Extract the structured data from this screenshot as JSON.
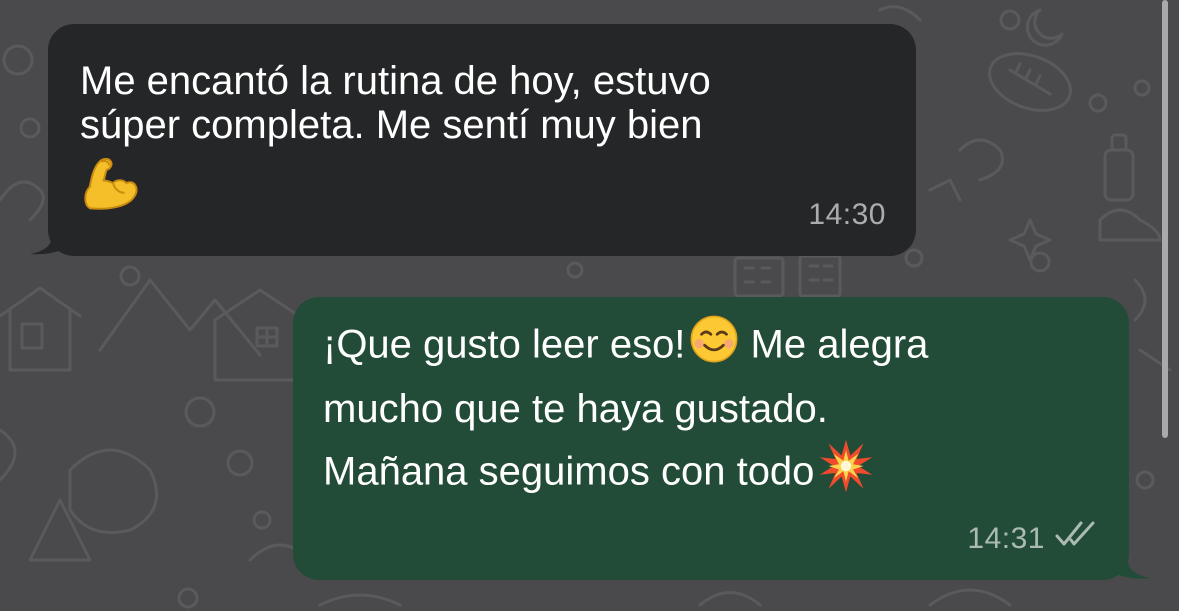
{
  "chat": {
    "background_color": "#4a4a4c",
    "incoming_color": "#252627",
    "outgoing_color": "#224c38",
    "messages": [
      {
        "direction": "incoming",
        "text": "Me encantó la rutina de hoy, estuvo súper completa. Me sentí muy bien",
        "line1": "Me encantó la rutina de hoy, estuvo",
        "line2": "súper completa. Me sentí muy bien",
        "emoji_icon": "flexed-biceps-icon",
        "time": "14:30"
      },
      {
        "direction": "outgoing",
        "line1": "¡Que gusto leer eso!",
        "line1_emoji_icon": "smiling-face-icon",
        "line1_after": " Me alegra",
        "line2": "mucho que te haya gustado.",
        "line3": "Mañana seguimos con todo",
        "line3_emoji_icon": "collision-icon",
        "time": "14:31",
        "status_icon": "double-check-icon"
      }
    ]
  }
}
